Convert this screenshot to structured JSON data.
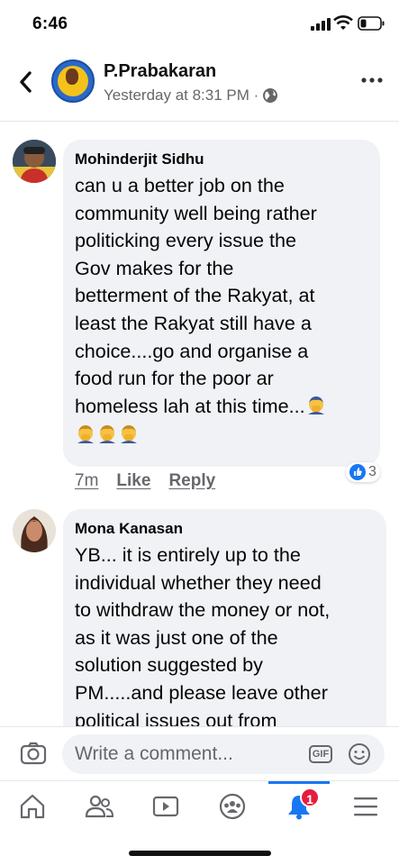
{
  "status_bar": {
    "time": "6:46"
  },
  "header": {
    "name": "P.Prabakaran",
    "subtitle": "Yesterday at 8:31 PM ·",
    "icons": [
      "back-chevron-icon",
      "globe-icon",
      "more-dots-icon"
    ]
  },
  "comments": [
    {
      "author": "Mohinderjit Sidhu",
      "lines": [
        "can u a better job on the",
        "community well being rather",
        "politicking every issue the",
        "Gov makes for the",
        "betterment of the Rakyat, at",
        "least the Rakyat still have a",
        "choice....go and organise a",
        "food run for the poor ar",
        "homeless lah at this time..."
      ],
      "emoji": "face-palm-emoji",
      "time": "7m",
      "like_label": "Like",
      "reply_label": "Reply",
      "reaction_count": "3",
      "reaction_icon": "thumbs-up-icon"
    },
    {
      "author": "Mona Kanasan",
      "lines": [
        "YB... it is entirely up to the",
        "individual whether they need",
        "to withdraw the money or not,",
        "as it was just one of the",
        "solution suggested by",
        "PM.....and please leave other",
        "political issues out from"
      ]
    }
  ],
  "composer": {
    "placeholder": "Write a comment...",
    "gif_label": "GIF"
  },
  "nav": {
    "items": [
      "home-icon",
      "friends-icon",
      "watch-icon",
      "groups-icon",
      "notifications-icon",
      "menu-icon"
    ],
    "notification_badge": "1"
  },
  "colors": {
    "accent": "#1877f2",
    "badge": "#e41e3f",
    "bubble": "#f0f2f5",
    "secondary_text": "#65676b"
  }
}
